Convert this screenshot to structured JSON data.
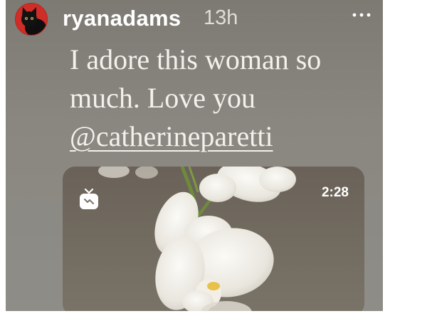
{
  "post": {
    "username": "ryanadams",
    "timestamp": "13h",
    "caption_text": "I adore this woman so much. Love you ",
    "mention": "@catherineparetti"
  },
  "video": {
    "duration": "2:28",
    "type_icon": "igtv-icon"
  },
  "icons": {
    "avatar": "black-cat-avatar",
    "more": "more-options-icon"
  },
  "colors": {
    "avatar_ring": "#d5312c",
    "text": "#ffffff",
    "background": "#85827c"
  }
}
